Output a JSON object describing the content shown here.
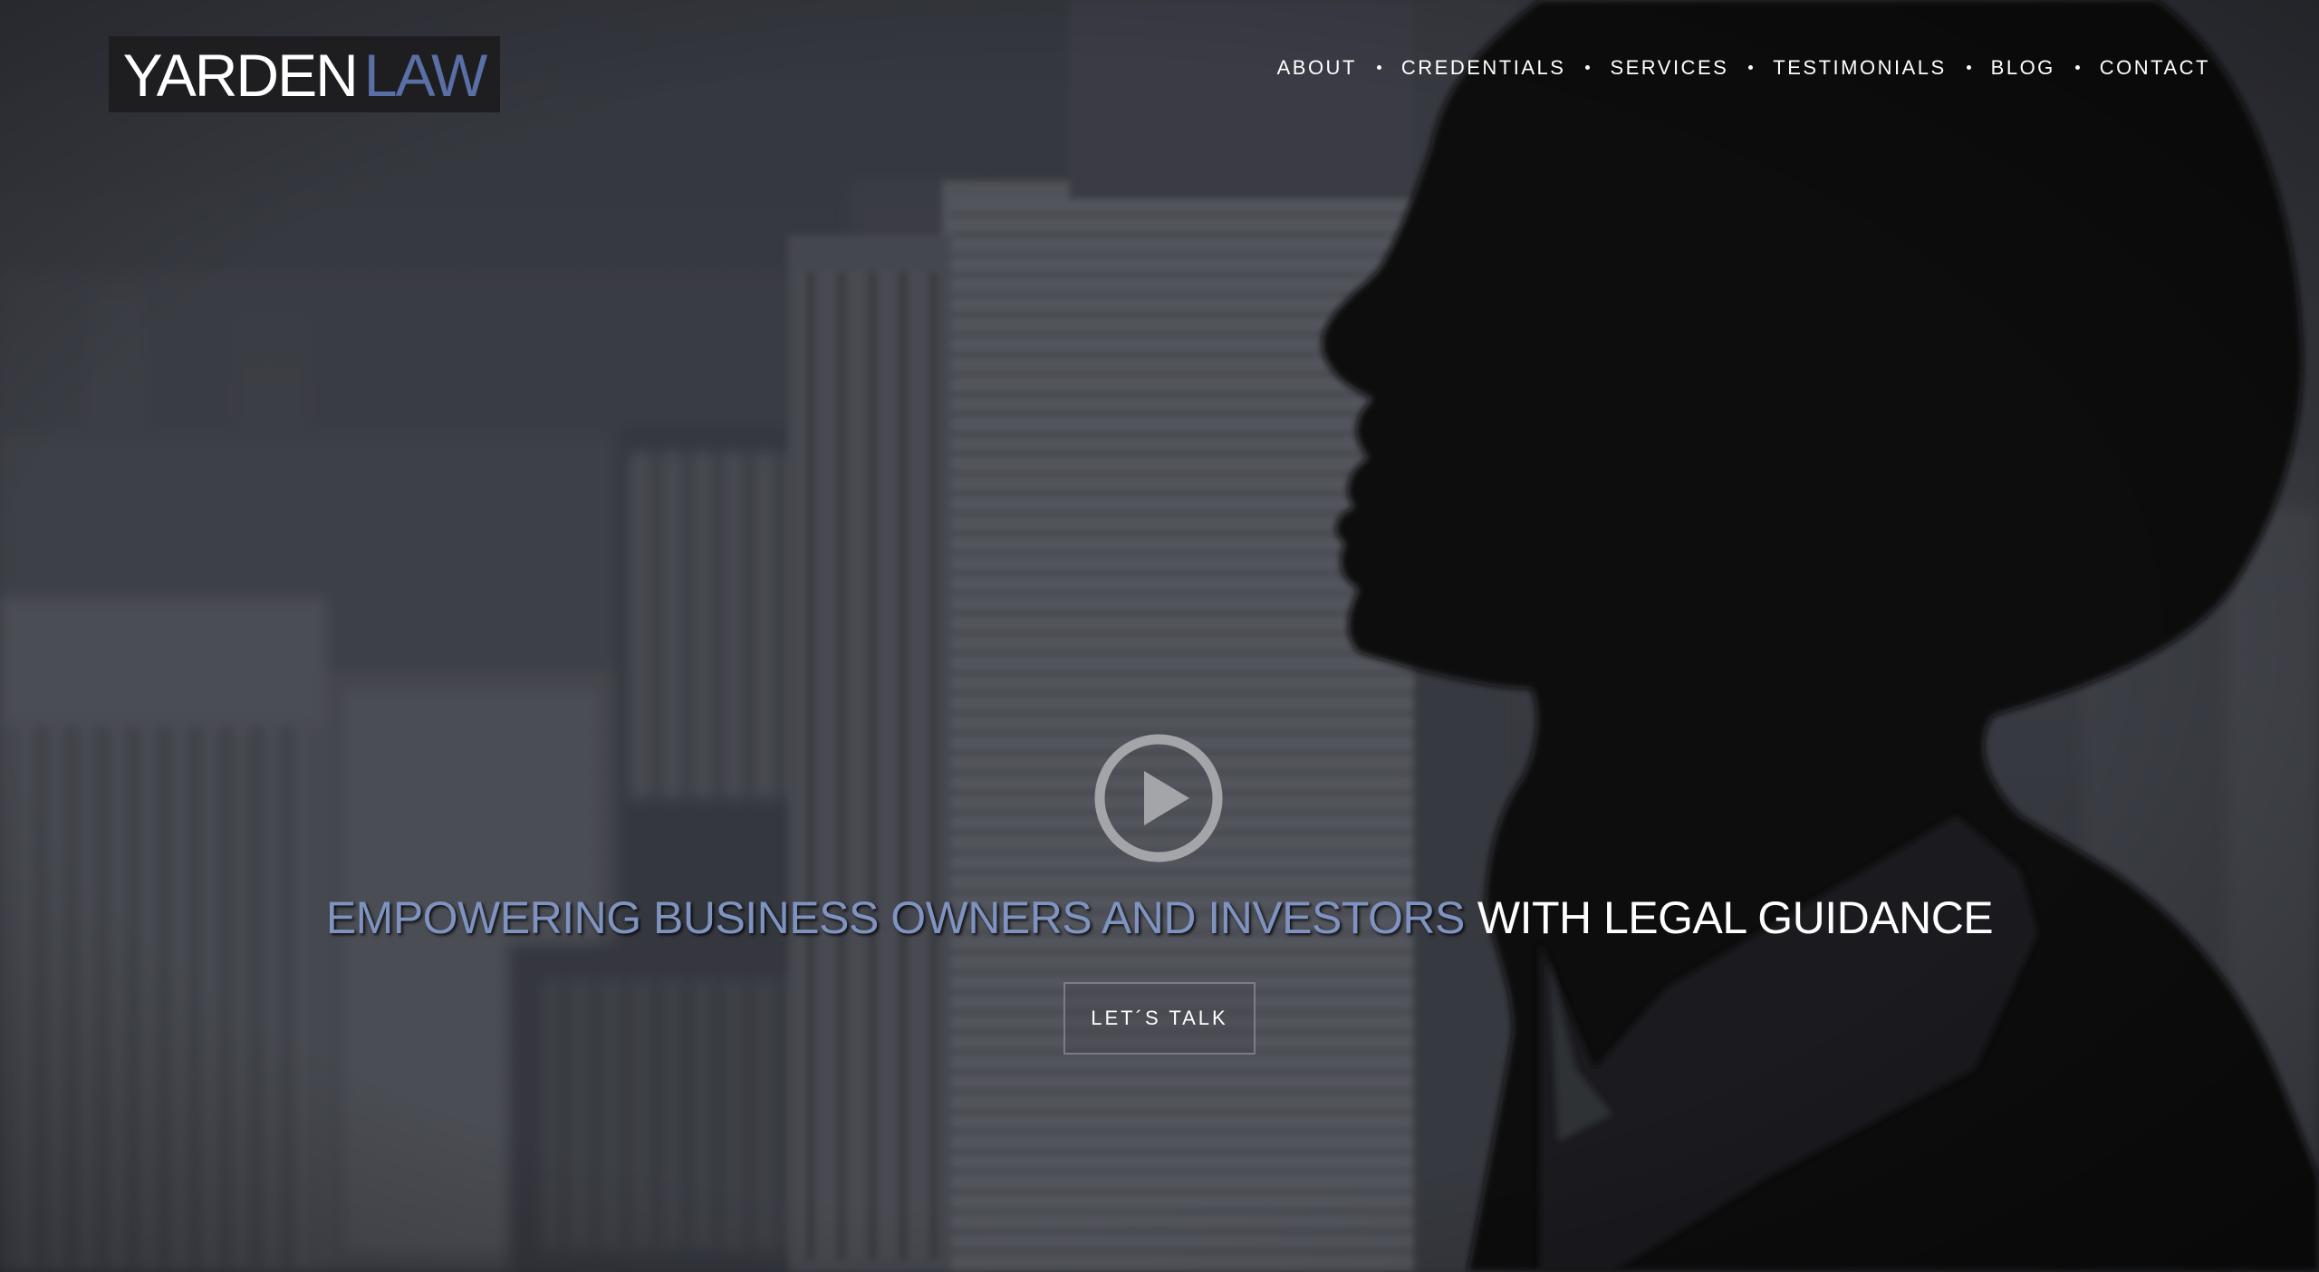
{
  "logo": {
    "part1": "YARDEN",
    "part2": "LAW"
  },
  "nav": {
    "items": [
      {
        "label": "ABOUT"
      },
      {
        "label": "CREDENTIALS"
      },
      {
        "label": "SERVICES"
      },
      {
        "label": "TESTIMONIALS"
      },
      {
        "label": "BLOG"
      },
      {
        "label": "CONTACT"
      }
    ]
  },
  "hero": {
    "headline_accent": "EMPOWERING BUSINESS OWNERS AND INVESTORS",
    "headline_main": "WITH LEGAL GUIDANCE",
    "cta_label": "LET´S TALK",
    "play_icon": "play-circle-icon"
  },
  "colors": {
    "accent": "#7f93c0",
    "logo_accent": "#5a6fa5",
    "logo_bg": "#1e1d20",
    "overlay": "#3a3c44"
  }
}
